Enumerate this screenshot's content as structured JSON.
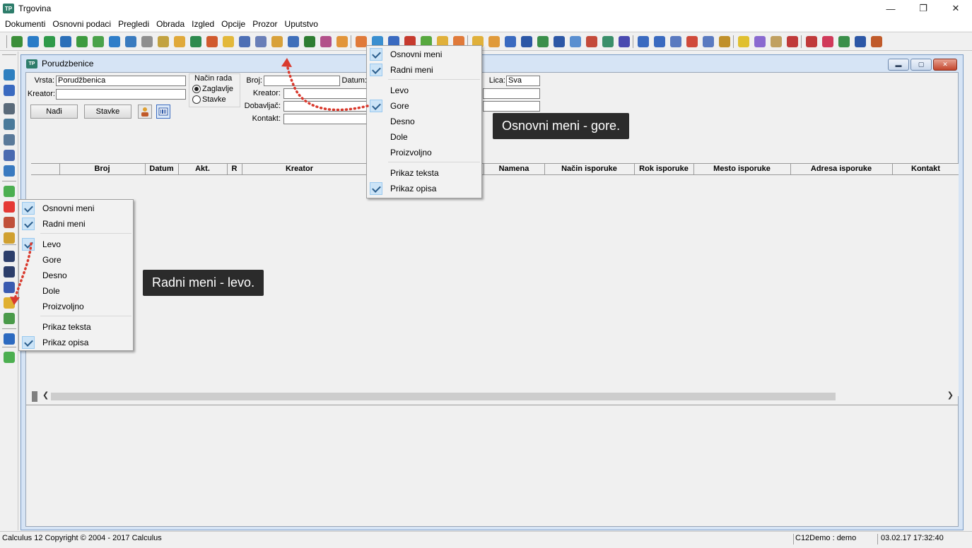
{
  "window": {
    "title": "Trgovina",
    "app_icon_text": "TP"
  },
  "menubar": [
    "Dokumenti",
    "Osnovni podaci",
    "Pregledi",
    "Obrada",
    "Izgled",
    "Opcije",
    "Prozor",
    "Uputstvo"
  ],
  "toolbar": {
    "buttons": [
      {
        "name": "toolbar-icon-1",
        "color": "#3c8f3a"
      },
      {
        "name": "toolbar-icon-2",
        "color": "#2a7cc7"
      },
      {
        "name": "toolbar-icon-3",
        "color": "#2f9a4a"
      },
      {
        "name": "toolbar-icon-4",
        "color": "#2b6fb8"
      },
      {
        "name": "toolbar-icon-5",
        "color": "#3d9b3f"
      },
      {
        "name": "toolbar-icon-6",
        "color": "#4aa24a"
      },
      {
        "name": "toolbar-icon-7",
        "color": "#2f7ec9"
      },
      {
        "name": "toolbar-icon-8",
        "color": "#3a7bbf"
      },
      {
        "name": "toolbar-icon-9",
        "color": "#8f8f8f"
      },
      {
        "name": "toolbar-icon-10",
        "color": "#c2a240"
      },
      {
        "name": "toolbar-icon-11",
        "color": "#e0a93a"
      },
      {
        "name": "toolbar-icon-12",
        "color": "#2d8a4e"
      },
      {
        "name": "toolbar-icon-13",
        "color": "#d15a2e"
      },
      {
        "name": "toolbar-icon-14",
        "color": "#e3b83a"
      },
      {
        "name": "toolbar-icon-15",
        "color": "#4d6fb5"
      },
      {
        "name": "toolbar-icon-16",
        "color": "#6a7fb8"
      },
      {
        "name": "toolbar-icon-17",
        "color": "#d8a13a"
      },
      {
        "name": "toolbar-icon-18",
        "color": "#3f6fba"
      },
      {
        "name": "toolbar-icon-19",
        "color": "#2e7d32"
      },
      {
        "name": "toolbar-icon-20",
        "color": "#b2508a"
      },
      {
        "name": "toolbar-icon-21",
        "color": "#e2953a"
      }
    ],
    "buttons2": [
      {
        "name": "toolbar-icon-22",
        "color": "#e07a3a"
      },
      {
        "name": "toolbar-icon-23",
        "color": "#3a8fd0"
      },
      {
        "name": "toolbar-icon-24",
        "color": "#3a6ac0"
      },
      {
        "name": "toolbar-icon-25",
        "color": "#c63a2e"
      },
      {
        "name": "toolbar-icon-26",
        "color": "#57a83f"
      },
      {
        "name": "toolbar-icon-27",
        "color": "#e0b03a"
      },
      {
        "name": "toolbar-icon-28",
        "color": "#e07a3a"
      }
    ],
    "buttons3": [
      {
        "name": "toolbar-icon-29",
        "color": "#e0b03a"
      },
      {
        "name": "toolbar-icon-30",
        "color": "#e09a3a"
      },
      {
        "name": "toolbar-icon-31",
        "color": "#3a6ac0"
      },
      {
        "name": "toolbar-icon-32",
        "color": "#2c57a6"
      },
      {
        "name": "toolbar-icon-33",
        "color": "#3a8f4a"
      },
      {
        "name": "toolbar-icon-34",
        "color": "#2c57a6"
      },
      {
        "name": "toolbar-icon-35",
        "color": "#5a8fd0"
      },
      {
        "name": "toolbar-icon-36",
        "color": "#c44a3a"
      },
      {
        "name": "toolbar-icon-37",
        "color": "#3a8f6a"
      },
      {
        "name": "toolbar-icon-38",
        "color": "#4a4ab0"
      },
      {
        "name": "toolbar-icon-39",
        "color": "#3a6ac0"
      },
      {
        "name": "toolbar-icon-40",
        "color": "#3a6ac0"
      },
      {
        "name": "toolbar-icon-41",
        "color": "#5a7ac0"
      },
      {
        "name": "toolbar-icon-42",
        "color": "#d04a3a"
      },
      {
        "name": "toolbar-icon-43",
        "color": "#5a7ac0"
      },
      {
        "name": "toolbar-icon-44",
        "color": "#c0902a"
      },
      {
        "name": "toolbar-icon-45",
        "color": "#e0c030"
      },
      {
        "name": "toolbar-icon-46",
        "color": "#8a6ad0"
      },
      {
        "name": "toolbar-icon-47",
        "color": "#c0a060"
      },
      {
        "name": "toolbar-icon-48",
        "color": "#c03a3a"
      },
      {
        "name": "toolbar-icon-49",
        "color": "#c03a3a"
      },
      {
        "name": "toolbar-icon-50",
        "color": "#d03a5a"
      },
      {
        "name": "toolbar-icon-51",
        "color": "#3a8f4a"
      },
      {
        "name": "toolbar-icon-52",
        "color": "#2c57a6"
      },
      {
        "name": "toolbar-icon-53",
        "color": "#c05a2a"
      }
    ]
  },
  "left_toolbar": [
    {
      "name": "save-icon",
      "color": "#2e7fbf"
    },
    {
      "name": "save-as-icon",
      "color": "#3a6ac0"
    },
    {
      "name": "print-icon",
      "color": "#5a6a7a"
    },
    {
      "name": "print-preview-icon",
      "color": "#4a7a9a"
    },
    {
      "name": "export-icon",
      "color": "#5a7a9a"
    },
    {
      "name": "settings-icon",
      "color": "#4a6ab0"
    },
    {
      "name": "zoom-icon",
      "color": "#3a7ac0"
    },
    {
      "name": "add-icon",
      "color": "#4caf50"
    },
    {
      "name": "delete-icon",
      "color": "#e53935"
    },
    {
      "name": "undo-icon",
      "color": "#c0503a"
    },
    {
      "name": "edit-icon",
      "color": "#d0a030"
    },
    {
      "name": "find-icon",
      "color": "#2c3e6a"
    },
    {
      "name": "find-next-icon",
      "color": "#2c3e6a"
    },
    {
      "name": "sort-icon",
      "color": "#3a5ab0"
    },
    {
      "name": "filter-icon",
      "color": "#e0b030"
    },
    {
      "name": "expand-icon",
      "color": "#4a9a4a"
    },
    {
      "name": "help-icon",
      "color": "#2c6ac0"
    },
    {
      "name": "exit-icon",
      "color": "#4caf50"
    }
  ],
  "mdi": {
    "title": "Porudzbenice",
    "icon_text": "TP"
  },
  "form": {
    "vrsta_label": "Vrsta:",
    "vrsta_value": "Porudžbenica",
    "kreator_label": "Kreator:",
    "kreator_value": "",
    "nacin_rada_label": "Način rada",
    "radio_zaglavlje": "Zaglavlje",
    "radio_stavke": "Stavke",
    "broj_label": "Broj:",
    "broj_value": "",
    "datum_label": "Datum:",
    "kreator2_label": "Kreator:",
    "dobavljac_label": "Dobavljač:",
    "kontakt_label": "Kontakt:",
    "lica_label": "Lica:",
    "lica_value": "Sva",
    "btn_nadji": "Nađi",
    "btn_stavke": "Stavke"
  },
  "grid": {
    "columns": [
      "Broj",
      "Datum",
      "Akt.",
      "R",
      "Kreator",
      "Namena",
      "Način isporuke",
      "Rok isporuke",
      "Mesto isporuke",
      "Adresa isporuke",
      "Kontakt"
    ]
  },
  "popup_top": {
    "items": [
      {
        "label": "Osnovni meni",
        "checked": true
      },
      {
        "label": "Radni meni",
        "checked": true
      },
      {
        "label": "Levo",
        "checked": false
      },
      {
        "label": "Gore",
        "checked": true
      },
      {
        "label": "Desno",
        "checked": false
      },
      {
        "label": "Dole",
        "checked": false
      },
      {
        "label": "Proizvoljno",
        "checked": false
      },
      {
        "label": "Prikaz teksta",
        "checked": false
      },
      {
        "label": "Prikaz opisa",
        "checked": true
      }
    ]
  },
  "popup_left": {
    "items": [
      {
        "label": "Osnovni meni",
        "checked": true
      },
      {
        "label": "Radni meni",
        "checked": true
      },
      {
        "label": "Levo",
        "checked": true
      },
      {
        "label": "Gore",
        "checked": false
      },
      {
        "label": "Desno",
        "checked": false
      },
      {
        "label": "Dole",
        "checked": false
      },
      {
        "label": "Proizvoljno",
        "checked": false
      },
      {
        "label": "Prikaz teksta",
        "checked": false
      },
      {
        "label": "Prikaz opisa",
        "checked": true
      }
    ]
  },
  "callouts": {
    "top": "Osnovni meni - gore.",
    "left": "Radni meni - levo."
  },
  "statusbar": {
    "copyright": "Calculus 12  Copyright © 2004 - 2017  Calculus",
    "user": "C12Demo : demo",
    "datetime": "03.02.17 17:32:40"
  },
  "colors": {
    "mdi_frame": "#d6e4f5",
    "callout_bg": "#2b2b2b",
    "arrow": "#d93a2e",
    "check_bg": "#cce4f7"
  }
}
